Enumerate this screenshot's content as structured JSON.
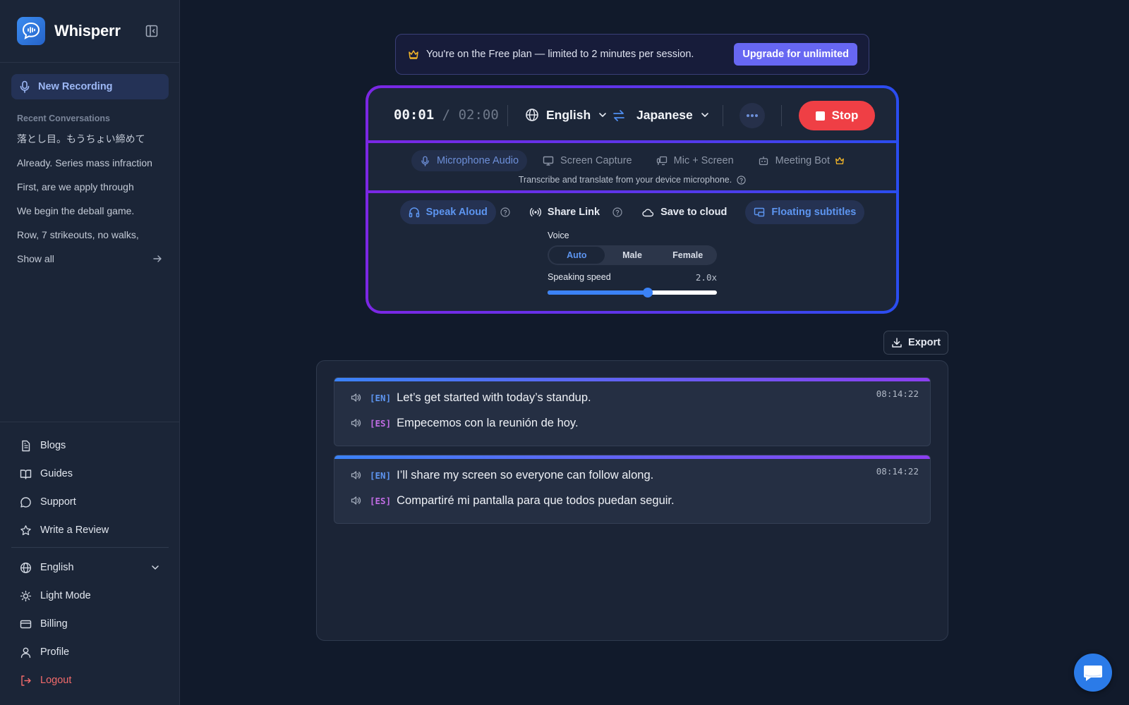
{
  "app": {
    "name": "Whisperr"
  },
  "sidebar": {
    "new_recording": "New Recording",
    "recent_title": "Recent Conversations",
    "recent": [
      "落とし目。もうちょい締めて",
      "Already. Series mass infraction",
      "First, are we apply through",
      "We begin the deball game.",
      "Row, 7 strikeouts, no walks,"
    ],
    "show_all": "Show all",
    "links": {
      "blogs": "Blogs",
      "guides": "Guides",
      "support": "Support",
      "review": "Write a Review"
    },
    "settings": {
      "language": "English",
      "theme": "Light Mode",
      "billing": "Billing",
      "profile": "Profile",
      "logout": "Logout"
    }
  },
  "banner": {
    "text": "You're on the Free plan — limited to 2 minutes per session.",
    "upgrade": "Upgrade for unlimited"
  },
  "recorder": {
    "elapsed": "00:01",
    "separator": "/",
    "limit": "02:00",
    "source_lang": "English",
    "target_lang": "Japanese",
    "stop": "Stop"
  },
  "sources": {
    "tabs": [
      "Microphone Audio",
      "Screen Capture",
      "Mic + Screen",
      "Meeting Bot"
    ],
    "active": 0,
    "description": "Transcribe and translate from your device microphone."
  },
  "outputs": {
    "speak_aloud": "Speak Aloud",
    "share_link": "Share Link",
    "save_cloud": "Save to cloud",
    "floating": "Floating subtitles",
    "voice_label": "Voice",
    "voice_options": [
      "Auto",
      "Male",
      "Female"
    ],
    "voice_selected": "Auto",
    "speed_label": "Speaking speed",
    "speed_value": "2.0x",
    "speed_fraction": 0.59
  },
  "export": "Export",
  "transcript": [
    {
      "time": "08:14:22",
      "src_tag": "[EN]",
      "src": "Let’s get started with today’s standup.",
      "tgt_tag": "[ES]",
      "tgt": "Empecemos con la reunión de hoy."
    },
    {
      "time": "08:14:22",
      "src_tag": "[EN]",
      "src": "I’ll share my screen so everyone can follow along.",
      "tgt_tag": "[ES]",
      "tgt": "Compartiré mi pantalla para que todos puedan seguir."
    }
  ],
  "colors": {
    "accent": "#3b82f6",
    "stop": "#ef3f45",
    "upgrade": "#6767f2"
  }
}
